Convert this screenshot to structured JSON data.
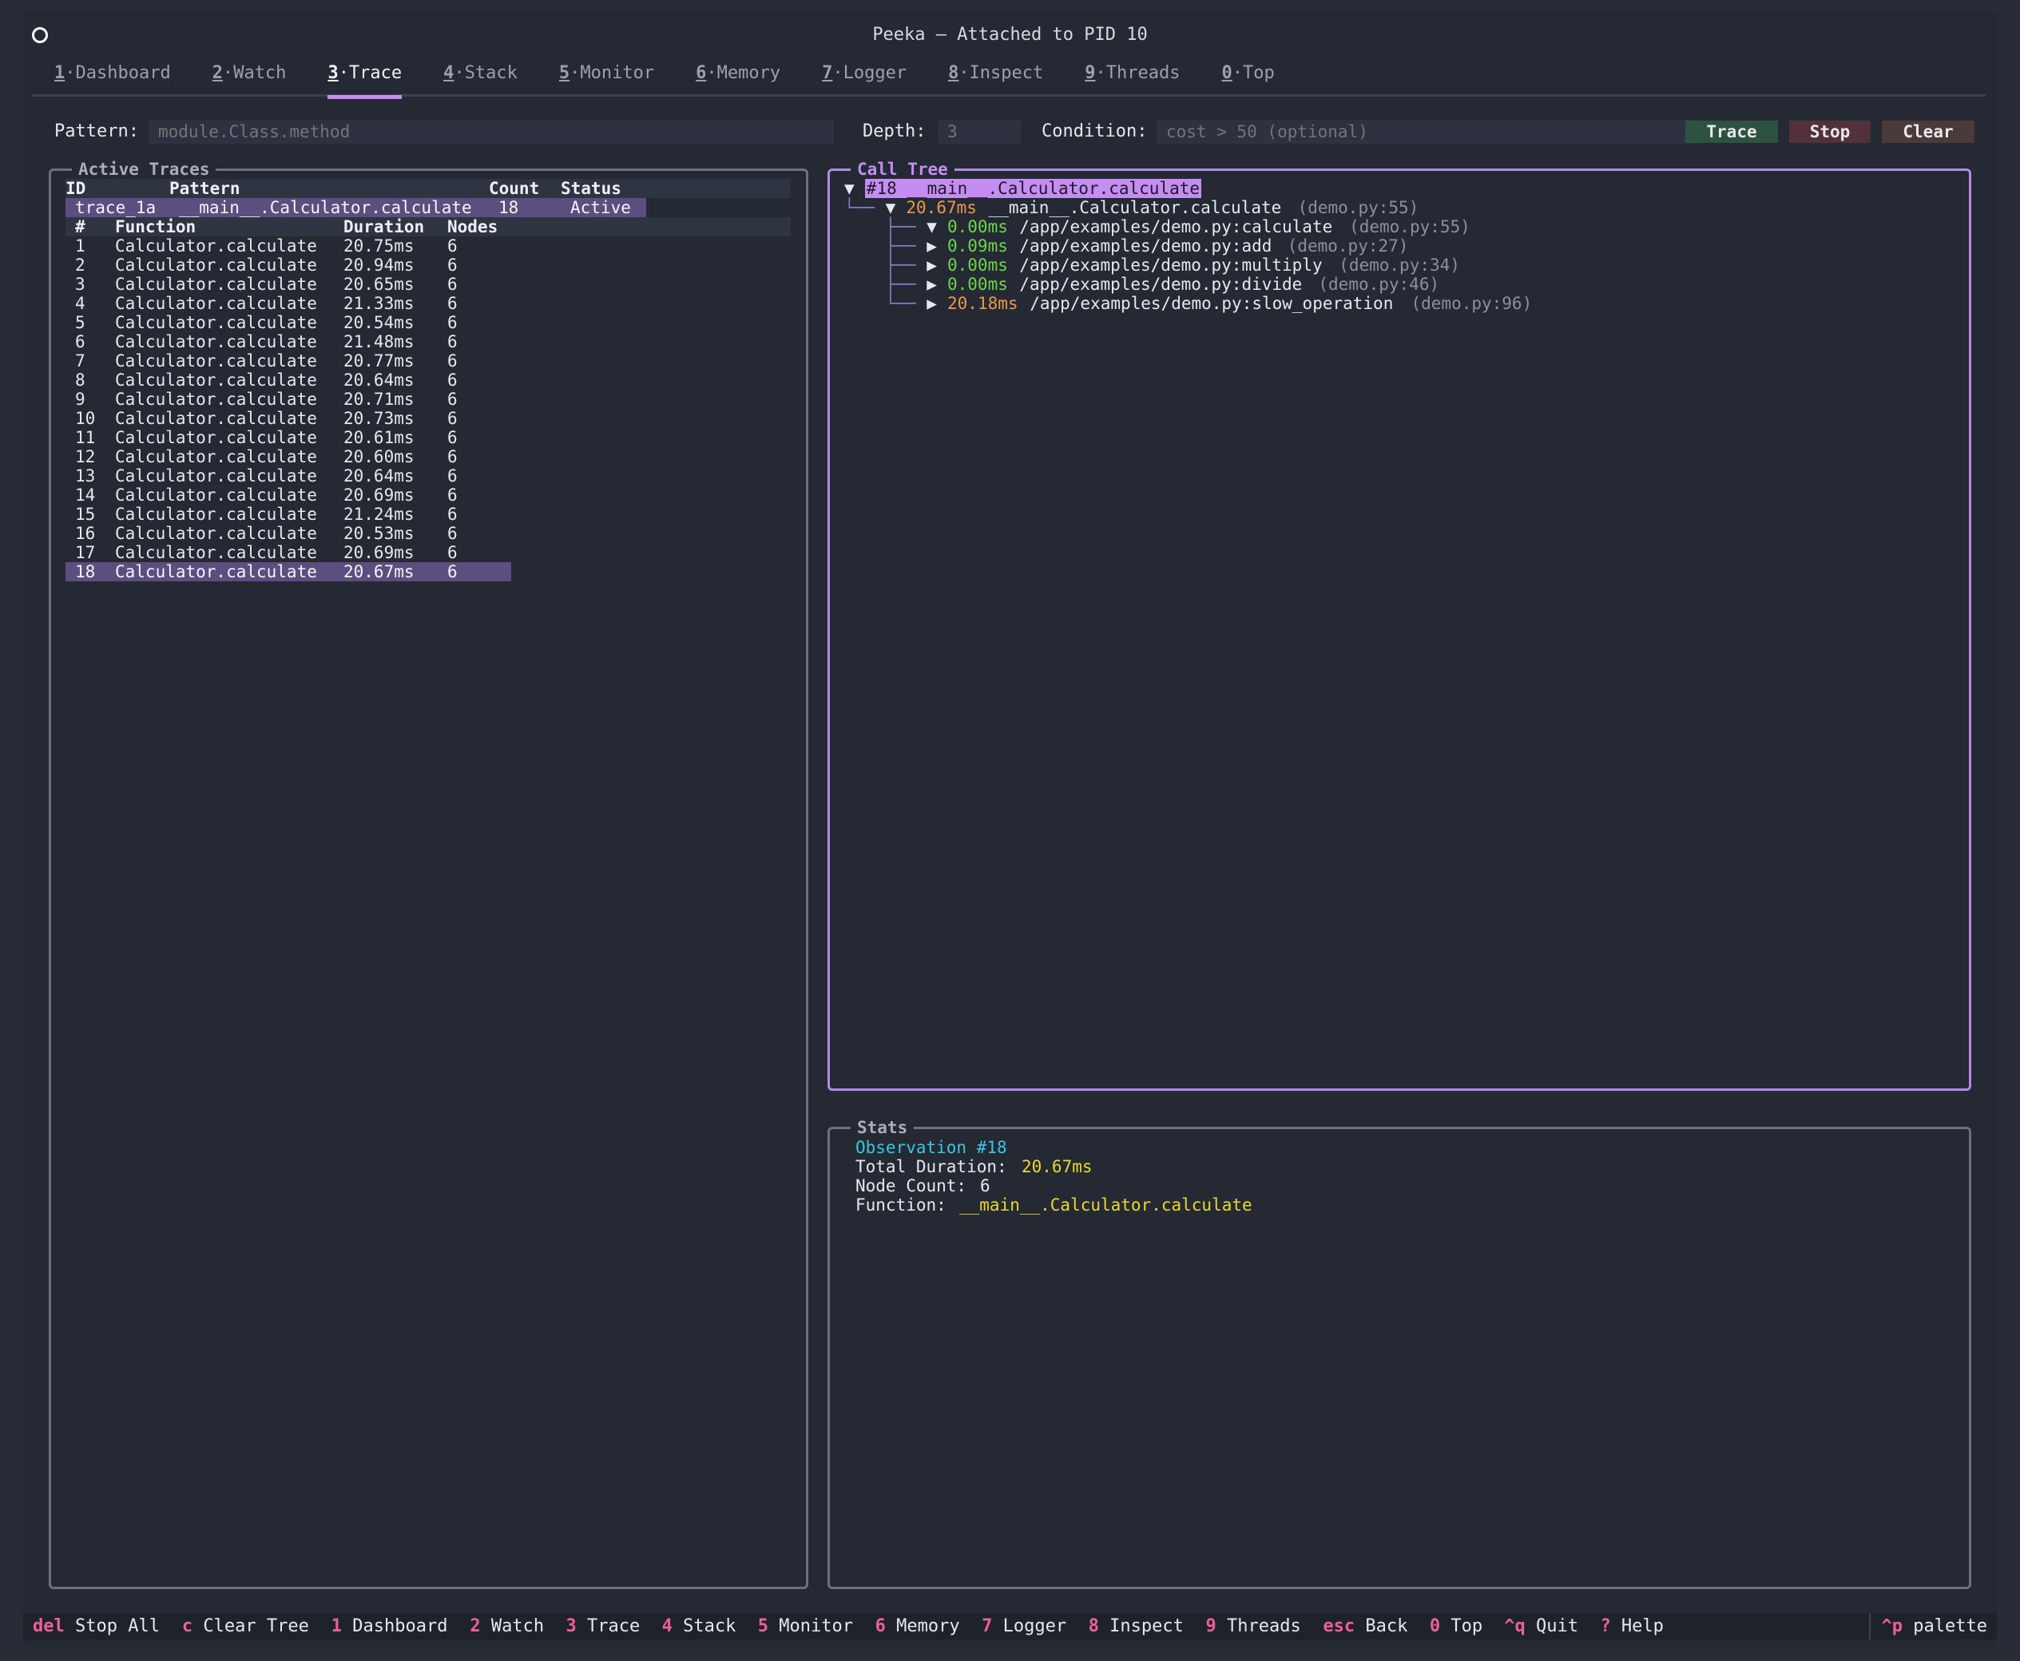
{
  "window": {
    "title": "Peeka — Attached to PID 10"
  },
  "tabs": [
    {
      "key": "1",
      "label": "·Dashboard"
    },
    {
      "key": "2",
      "label": "·Watch"
    },
    {
      "key": "3",
      "label": "·Trace"
    },
    {
      "key": "4",
      "label": "·Stack"
    },
    {
      "key": "5",
      "label": "·Monitor"
    },
    {
      "key": "6",
      "label": "·Memory"
    },
    {
      "key": "7",
      "label": "·Logger"
    },
    {
      "key": "8",
      "label": "·Inspect"
    },
    {
      "key": "9",
      "label": "·Threads"
    },
    {
      "key": "0",
      "label": "·Top"
    }
  ],
  "active_tab": "3",
  "form": {
    "pattern_label": "Pattern:",
    "pattern_placeholder": "module.Class.method",
    "depth_label": "Depth:",
    "depth_placeholder": "3",
    "condition_label": "Condition:",
    "condition_placeholder": "cost > 50 (optional)",
    "trace_button": "Trace",
    "stop_button": "Stop",
    "clear_button": "Clear",
    "colors": {
      "trace": "#2e5242",
      "stop": "#52303c",
      "clear": "#4a3a3a"
    }
  },
  "active_traces": {
    "title": "Active Traces",
    "headers": {
      "id": "ID",
      "pattern": "Pattern",
      "count": "Count",
      "status": "Status"
    },
    "traces": [
      {
        "id": "trace_1a",
        "pattern": "__main__.Calculator.calculate",
        "count": "18",
        "status": "Active"
      }
    ],
    "obs_headers": {
      "num": "#",
      "function": "Function",
      "duration": "Duration",
      "nodes": "Nodes"
    },
    "observations": [
      {
        "num": "1",
        "function": "Calculator.calculate",
        "duration": "20.75ms",
        "nodes": "6"
      },
      {
        "num": "2",
        "function": "Calculator.calculate",
        "duration": "20.94ms",
        "nodes": "6"
      },
      {
        "num": "3",
        "function": "Calculator.calculate",
        "duration": "20.65ms",
        "nodes": "6"
      },
      {
        "num": "4",
        "function": "Calculator.calculate",
        "duration": "21.33ms",
        "nodes": "6"
      },
      {
        "num": "5",
        "function": "Calculator.calculate",
        "duration": "20.54ms",
        "nodes": "6"
      },
      {
        "num": "6",
        "function": "Calculator.calculate",
        "duration": "21.48ms",
        "nodes": "6"
      },
      {
        "num": "7",
        "function": "Calculator.calculate",
        "duration": "20.77ms",
        "nodes": "6"
      },
      {
        "num": "8",
        "function": "Calculator.calculate",
        "duration": "20.64ms",
        "nodes": "6"
      },
      {
        "num": "9",
        "function": "Calculator.calculate",
        "duration": "20.71ms",
        "nodes": "6"
      },
      {
        "num": "10",
        "function": "Calculator.calculate",
        "duration": "20.73ms",
        "nodes": "6"
      },
      {
        "num": "11",
        "function": "Calculator.calculate",
        "duration": "20.61ms",
        "nodes": "6"
      },
      {
        "num": "12",
        "function": "Calculator.calculate",
        "duration": "20.60ms",
        "nodes": "6"
      },
      {
        "num": "13",
        "function": "Calculator.calculate",
        "duration": "20.64ms",
        "nodes": "6"
      },
      {
        "num": "14",
        "function": "Calculator.calculate",
        "duration": "20.69ms",
        "nodes": "6"
      },
      {
        "num": "15",
        "function": "Calculator.calculate",
        "duration": "21.24ms",
        "nodes": "6"
      },
      {
        "num": "16",
        "function": "Calculator.calculate",
        "duration": "20.53ms",
        "nodes": "6"
      },
      {
        "num": "17",
        "function": "Calculator.calculate",
        "duration": "20.69ms",
        "nodes": "6"
      },
      {
        "num": "18",
        "function": "Calculator.calculate",
        "duration": "20.67ms",
        "nodes": "6"
      }
    ],
    "selected_observation": "18"
  },
  "call_tree": {
    "title": "Call Tree",
    "root": {
      "arrow": "▼",
      "label": "#18 __main__.Calculator.calculate"
    },
    "child": {
      "connector": "└──",
      "arrow": "▼",
      "duration": "20.67ms",
      "name": "__main__.Calculator.calculate",
      "location": "(demo.py:55)"
    },
    "grandchildren": [
      {
        "connector": "├──",
        "arrow": "▼",
        "duration": "0.00ms",
        "duration_color": "green",
        "name": "/app/examples/demo.py:calculate",
        "location": "(demo.py:55)"
      },
      {
        "connector": "├──",
        "arrow": "▶",
        "duration": "0.09ms",
        "duration_color": "green",
        "name": "/app/examples/demo.py:add",
        "location": "(demo.py:27)"
      },
      {
        "connector": "├──",
        "arrow": "▶",
        "duration": "0.00ms",
        "duration_color": "green",
        "name": "/app/examples/demo.py:multiply",
        "location": "(demo.py:34)"
      },
      {
        "connector": "├──",
        "arrow": "▶",
        "duration": "0.00ms",
        "duration_color": "green",
        "name": "/app/examples/demo.py:divide",
        "location": "(demo.py:46)"
      },
      {
        "connector": "└──",
        "arrow": "▶",
        "duration": "20.18ms",
        "duration_color": "orange",
        "name": "/app/examples/demo.py:slow_operation",
        "location": "(demo.py:96)"
      }
    ]
  },
  "stats": {
    "title": "Stats",
    "observation": "Observation #18",
    "total_duration_label": "Total Duration: ",
    "total_duration": "20.67ms",
    "node_count_label": "Node Count: ",
    "node_count": "6",
    "function_label": "Function: ",
    "function": "__main__.Calculator.calculate"
  },
  "status_bar": [
    {
      "key": "del",
      "label": " Stop All"
    },
    {
      "key": "c",
      "label": " Clear Tree"
    },
    {
      "key": "1",
      "label": " Dashboard"
    },
    {
      "key": "2",
      "label": " Watch"
    },
    {
      "key": "3",
      "label": " Trace"
    },
    {
      "key": "4",
      "label": " Stack"
    },
    {
      "key": "5",
      "label": " Monitor"
    },
    {
      "key": "6",
      "label": " Memory"
    },
    {
      "key": "7",
      "label": " Logger"
    },
    {
      "key": "8",
      "label": " Inspect"
    },
    {
      "key": "9",
      "label": " Threads"
    },
    {
      "key": "esc",
      "label": " Back"
    },
    {
      "key": "0",
      "label": " Top"
    },
    {
      "key": "^q",
      "label": " Quit"
    },
    {
      "key": "?",
      "label": " Help"
    }
  ],
  "status_bar_right": {
    "key": "^p",
    "label": " palette"
  }
}
